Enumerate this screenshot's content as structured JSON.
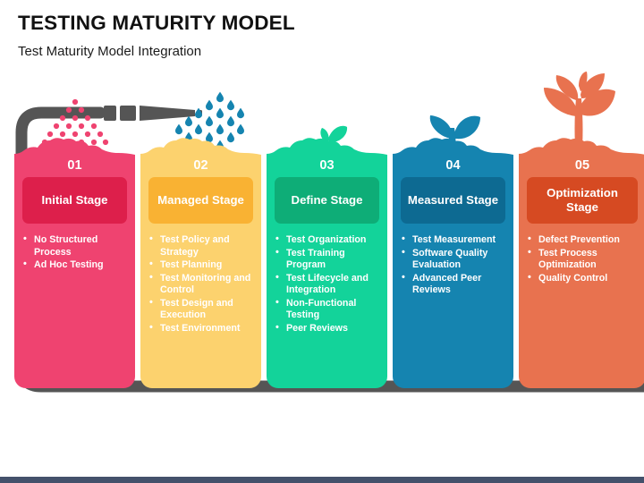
{
  "header": {
    "title": "TESTING MATURITY MODEL",
    "subtitle": "Test Maturity Model Integration"
  },
  "colors": {
    "stage1": "#ef4370",
    "stage1_badge": "#dd1f4b",
    "stage2": "#fcd26e",
    "stage2_badge": "#f9b233",
    "stage3": "#13d39a",
    "stage3_badge": "#0ead77",
    "stage4": "#1584b0",
    "stage4_badge": "#0d6a92",
    "stage5": "#e8724f",
    "stage5_badge": "#d64a22",
    "hose": "#555555",
    "bottom_bar": "#44516b",
    "title_text": "#111111"
  },
  "stages": [
    {
      "number": "01",
      "label": "Initial Stage",
      "color": "#ef4370",
      "badge_color": "#dd1f4b",
      "decoration": "pink-dot-spray-icon",
      "items": [
        "No Structured Process",
        "Ad Hoc Testing"
      ]
    },
    {
      "number": "02",
      "label": "Managed Stage",
      "color": "#fcd26e",
      "badge_color": "#f9b233",
      "decoration": "water-droplets-icon",
      "items": [
        "Test Policy and Strategy",
        "Test Planning",
        "Test Monitoring and Control",
        "Test Design and Execution",
        "Test Environment"
      ]
    },
    {
      "number": "03",
      "label": "Define Stage",
      "color": "#13d39a",
      "badge_color": "#0ead77",
      "decoration": "sprout-small-icon",
      "items": [
        "Test Organization",
        "Test Training Program",
        "Test Lifecycle and Integration",
        "Non-Functional Testing",
        "Peer Reviews"
      ]
    },
    {
      "number": "04",
      "label": "Measured Stage",
      "color": "#1584b0",
      "badge_color": "#0d6a92",
      "decoration": "sprout-medium-icon",
      "items": [
        "Test Measurement",
        "Software Quality Evaluation",
        "Advanced Peer Reviews"
      ]
    },
    {
      "number": "05",
      "label": "Optimization Stage",
      "color": "#e8724f",
      "badge_color": "#d64a22",
      "decoration": "plant-large-icon",
      "items": [
        "Defect Prevention",
        "Test Process Optimization",
        "Quality Control"
      ]
    }
  ]
}
